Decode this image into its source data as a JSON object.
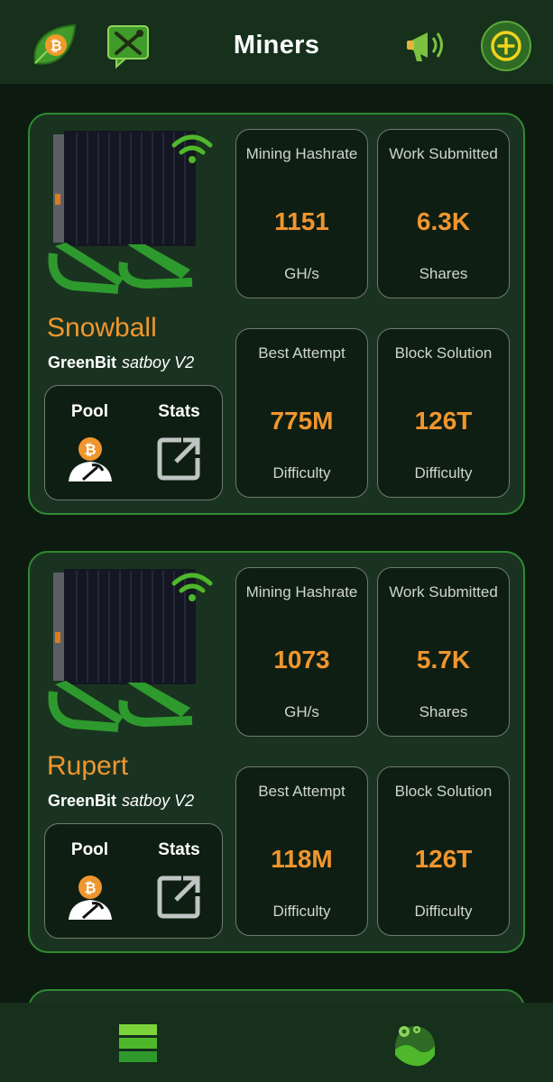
{
  "header": {
    "title": "Miners"
  },
  "miners": [
    {
      "name": "Snowball",
      "brand": "GreenBit",
      "variant": "satboy V2",
      "pool_label": "Pool",
      "stats_label": "Stats",
      "hashrate": {
        "label": "Mining Hashrate",
        "value": "1151",
        "unit": "GH/s"
      },
      "work": {
        "label": "Work Submitted",
        "value": "6.3K",
        "unit": "Shares"
      },
      "best": {
        "label": "Best Attempt",
        "value": "775M",
        "unit": "Difficulty"
      },
      "block": {
        "label": "Block Solution",
        "value": "126T",
        "unit": "Difficulty"
      }
    },
    {
      "name": "Rupert",
      "brand": "GreenBit",
      "variant": "satboy V2",
      "pool_label": "Pool",
      "stats_label": "Stats",
      "hashrate": {
        "label": "Mining Hashrate",
        "value": "1073",
        "unit": "GH/s"
      },
      "work": {
        "label": "Work Submitted",
        "value": "5.7K",
        "unit": "Shares"
      },
      "best": {
        "label": "Best Attempt",
        "value": "118M",
        "unit": "Difficulty"
      },
      "block": {
        "label": "Block Solution",
        "value": "126T",
        "unit": "Difficulty"
      }
    }
  ],
  "colors": {
    "accent": "#f0962e",
    "card_border": "#2f8a32",
    "card_bg": "#1a3320",
    "header_bg": "#16301c"
  },
  "icons": {
    "logo": "bitcoin-leaf-icon",
    "tools": "tools-chat-icon",
    "announce": "megaphone-icon",
    "add": "add-circle-icon",
    "pool": "miner-pool-icon",
    "stats": "open-external-icon",
    "nav_miners": "miners-list-icon",
    "nav_settings": "settings-wave-icon"
  }
}
